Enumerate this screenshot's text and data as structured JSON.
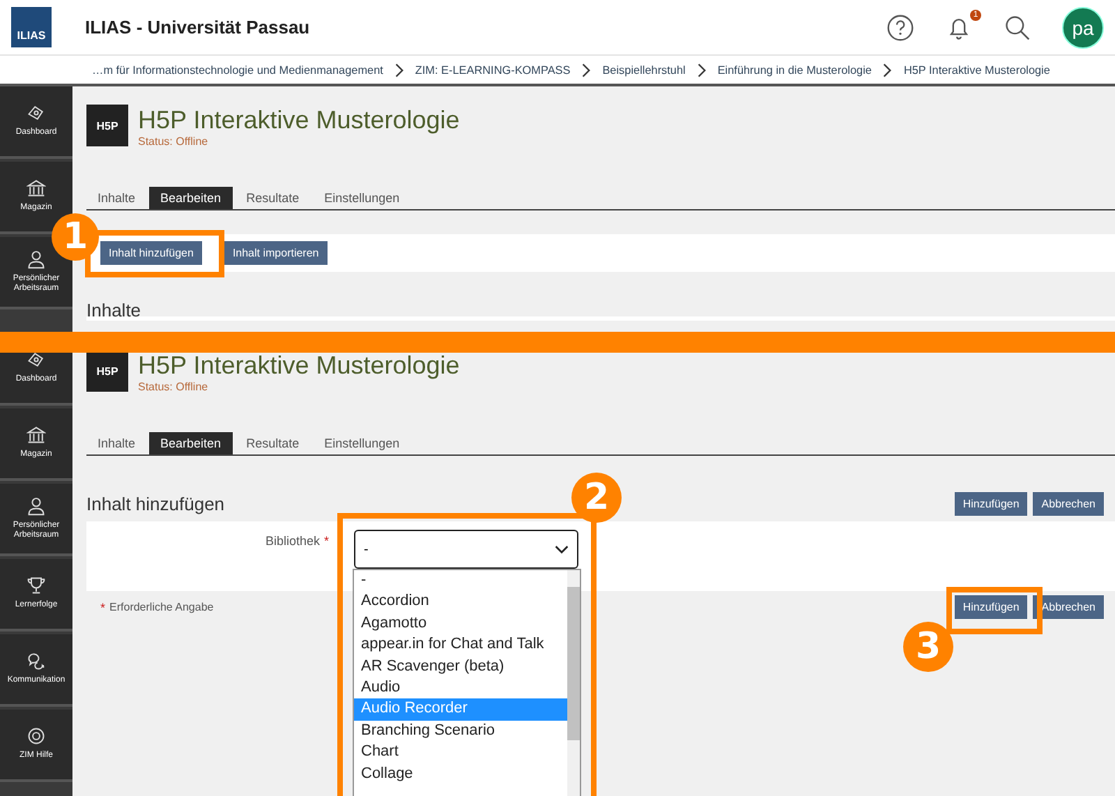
{
  "header": {
    "logo_text": "ILIAS",
    "title": "ILIAS - Universität Passau",
    "notification_count": "1",
    "avatar": "pa"
  },
  "breadcrumbs": [
    "…m für Informationstechnologie und Medienmanagement",
    "ZIM: E-LEARNING-KOMPASS",
    "Beispiellehrstuhl",
    "Einführung in die Musterologie",
    "H5P Interaktive Musterologie"
  ],
  "panels": [
    {
      "kind": "content",
      "sidebar": [
        "Dashboard",
        "Magazin",
        "Persönlicher Arbeitsraum"
      ],
      "logo_text": "H5P",
      "title": "H5P Interaktive Musterologie",
      "status": "Status: Offline",
      "tabs": [
        {
          "label": "Inhalte",
          "selected": false
        },
        {
          "label": "Bearbeiten",
          "selected": true
        },
        {
          "label": "Resultate",
          "selected": false
        },
        {
          "label": "Einstellungen",
          "selected": false
        }
      ],
      "buttons": [
        "Inhalt hinzufügen",
        "Inhalt importieren"
      ],
      "heading": "Inhalte"
    },
    {
      "kind": "form",
      "sidebar": [
        "Dashboard",
        "Magazin",
        "Persönlicher Arbeitsraum",
        "Lernerfolge",
        "Kommunikation",
        "ZIM Hilfe"
      ],
      "logo_text": "H5P",
      "title": "H5P Interaktive Musterologie",
      "status": "Status: Offline",
      "tabs": [
        {
          "label": "Inhalte",
          "selected": false
        },
        {
          "label": "Bearbeiten",
          "selected": true
        },
        {
          "label": "Resultate",
          "selected": false
        },
        {
          "label": "Einstellungen",
          "selected": false
        }
      ],
      "heading": "Inhalt hinzufügen",
      "top_buttons": [
        "Hinzufügen",
        "Abbrechen"
      ],
      "field_label": "Bibliothek",
      "required_mark": "*",
      "select_value": "-",
      "options": [
        {
          "label": "-",
          "selected": false
        },
        {
          "label": "Accordion",
          "selected": false
        },
        {
          "label": "Agamotto",
          "selected": false
        },
        {
          "label": "appear.in for Chat and Talk",
          "selected": false
        },
        {
          "label": "AR Scavenger (beta)",
          "selected": false
        },
        {
          "label": "Audio",
          "selected": false
        },
        {
          "label": "Audio Recorder",
          "selected": true
        },
        {
          "label": "Branching Scenario",
          "selected": false
        },
        {
          "label": "Chart",
          "selected": false
        },
        {
          "label": "Collage",
          "selected": false
        }
      ],
      "required_note_mark": "*",
      "required_note": "Erforderliche Angabe",
      "bottom_buttons": [
        "Hinzufügen",
        "Abbrechen"
      ]
    }
  ],
  "annotations": [
    {
      "number": "1"
    },
    {
      "number": "2"
    },
    {
      "number": "3"
    }
  ]
}
